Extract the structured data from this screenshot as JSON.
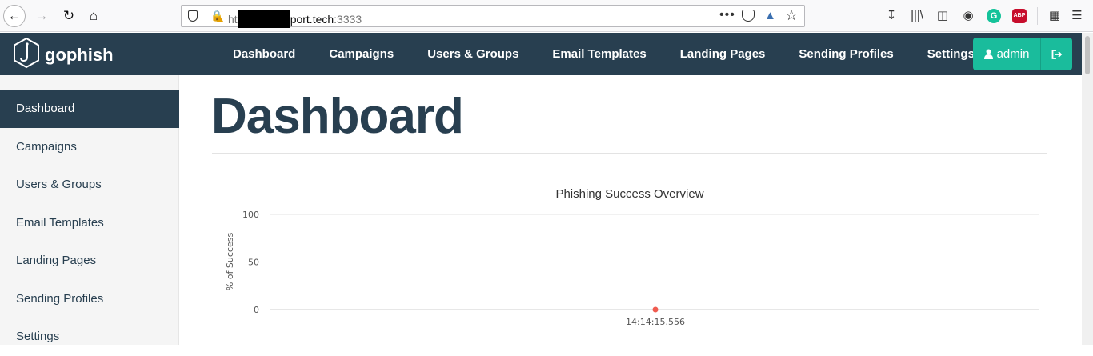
{
  "browser": {
    "url_prefix": "ht",
    "url_host": "port.tech",
    "url_port": ":3333"
  },
  "navbar": {
    "brand": "gophish",
    "links": [
      "Dashboard",
      "Campaigns",
      "Users & Groups",
      "Email Templates",
      "Landing Pages",
      "Sending Profiles",
      "Settings"
    ],
    "user_label": "admin",
    "colors": {
      "bar": "#283f50",
      "accent": "#1abc9c"
    }
  },
  "sidebar": {
    "items": [
      "Dashboard",
      "Campaigns",
      "Users & Groups",
      "Email Templates",
      "Landing Pages",
      "Sending Profiles",
      "Settings"
    ],
    "active": "Dashboard"
  },
  "main": {
    "title": "Dashboard"
  },
  "chart_data": {
    "type": "line",
    "title": "Phishing Success Overview",
    "xlabel": "",
    "ylabel": "% of Success",
    "yticks": [
      100,
      50,
      0
    ],
    "ylim": [
      0,
      100
    ],
    "x": [
      "14:14:15.556"
    ],
    "series": [
      {
        "values": [
          0
        ]
      }
    ],
    "grid": true,
    "point_color": "#f05b4f"
  }
}
